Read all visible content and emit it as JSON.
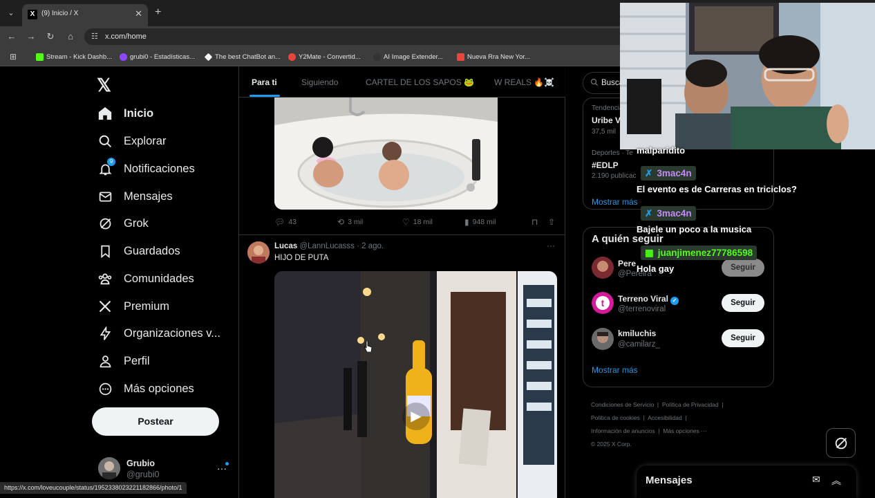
{
  "browser": {
    "tab_title": "(9) Inicio / X",
    "tab_close": "✕",
    "new_tab": "+",
    "url": "x.com/home",
    "bookmarks": [
      {
        "label": "Stream - Kick Dashb...",
        "color": "#53fc18"
      },
      {
        "label": "grubi0 - Estadísticas...",
        "color": "#9146ff"
      },
      {
        "label": "The best ChatBot an...",
        "color": "#ffffff"
      },
      {
        "label": "Y2Mate - Convertid...",
        "color": "#e8453c"
      },
      {
        "label": "AI Image Extender...",
        "color": "#222222"
      },
      {
        "label": "Nueva Rra New Yor...",
        "color": "#e8453c"
      }
    ],
    "status_url": "https://x.com/loveucouple/status/1952338023221182866/photo/1"
  },
  "nav": {
    "items": [
      {
        "label": "Inicio",
        "icon": "home-icon",
        "glyph": "⌂"
      },
      {
        "label": "Explorar",
        "icon": "search-icon",
        "glyph": "⌕"
      },
      {
        "label": "Notificaciones",
        "icon": "bell-icon",
        "glyph": "🔔︎",
        "badge": "9"
      },
      {
        "label": "Mensajes",
        "icon": "envelope-icon",
        "glyph": "✉"
      },
      {
        "label": "Grok",
        "icon": "grok-icon",
        "glyph": "⌀"
      },
      {
        "label": "Guardados",
        "icon": "bookmark-icon",
        "glyph": "⊓"
      },
      {
        "label": "Comunidades",
        "icon": "communities-icon",
        "glyph": "⚇"
      },
      {
        "label": "Premium",
        "icon": "x-premium-icon",
        "glyph": "𝕏"
      },
      {
        "label": "Organizaciones v...",
        "icon": "lightning-icon",
        "glyph": "ϟ"
      },
      {
        "label": "Perfil",
        "icon": "person-icon",
        "glyph": "⚲"
      },
      {
        "label": "Más opciones",
        "icon": "more-circle-icon",
        "glyph": "⋯"
      }
    ],
    "post_label": "Postear",
    "user": {
      "name": "Grubio",
      "handle": "@grubi0"
    }
  },
  "timeline": {
    "tabs": [
      "Para ti",
      "Siguiendo",
      "CARTEL DE LOS SAPOS 🐸",
      "W REALS 🔥☠️"
    ],
    "tweet1_actions": {
      "replies": "43",
      "reposts": "3 mil",
      "likes": "18 mil",
      "views": "948 mil"
    },
    "tweet2": {
      "name": "Lucas",
      "handle": "@LannLucasss",
      "sep": " · ",
      "date": "2 ago.",
      "text": "HIJO DE PUTA"
    }
  },
  "sidebar": {
    "search_placeholder": "Busca",
    "trends": [
      {
        "category": "Tendencia",
        "name": "Uribe V",
        "count": "37,5 mil"
      },
      {
        "category": "Deportes · Te",
        "name": "#EDLP",
        "count": "2.190 publicac"
      }
    ],
    "show_more": "Mostrar más",
    "follow_title": "A quién seguir",
    "follow": [
      {
        "name": "Pere",
        "handle": "@Pereira",
        "verified": false,
        "button": "Seguir"
      },
      {
        "name": "Terreno Viral",
        "handle": "@terrenoviral",
        "verified": true,
        "button": "Seguir"
      },
      {
        "name": "kmiluchis",
        "handle": "@camilarz_",
        "verified": false,
        "button": "Seguir"
      }
    ],
    "follow_show_more": "Mostrar más",
    "footer": [
      "Condiciones de Servicio",
      "Política de Privacidad",
      "Política de cookies",
      "Accesibilidad",
      "Información de anuncios",
      "Más opciones ···",
      "© 2025 X Corp."
    ]
  },
  "stream_chat": {
    "partial_user": "malparidito",
    "messages": [
      {
        "user": "3mac4n",
        "user_color": "#c58af9",
        "badge": "✗",
        "text": "El evento es de Carreras en triciclos?"
      },
      {
        "user": "3mac4n",
        "user_color": "#c58af9",
        "badge": "✗",
        "text": "Bajele un poco a la musica"
      },
      {
        "user": "juanjimenez77786598",
        "user_color": "#53fc18",
        "badge": "▦",
        "text": "Hola gay"
      }
    ]
  },
  "drawer": {
    "title": "Mensajes"
  },
  "colors": {
    "accent": "#1d9bf0",
    "background": "#000000",
    "border": "#2f3336",
    "muted": "#71767b"
  }
}
